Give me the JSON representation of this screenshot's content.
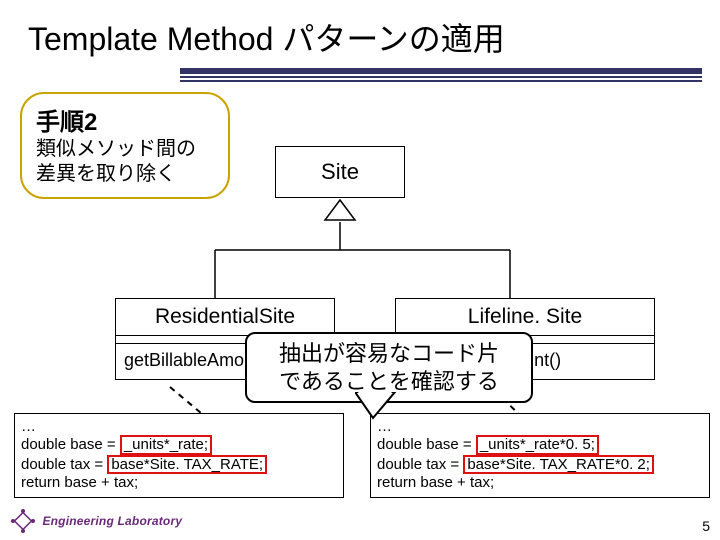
{
  "title": "Template Method パターンの適用",
  "step_box": {
    "heading": "手順2",
    "body_l1": "類似メソッド間の",
    "body_l2": "差異を取り除く"
  },
  "uml": {
    "parent": "Site",
    "left": {
      "name": "ResidentialSite",
      "op": "getBillableAmount()"
    },
    "right": {
      "name": "Lifeline. Site",
      "op": "getBillableAmount()"
    }
  },
  "speech": {
    "l1": "抽出が容易なコード片",
    "l2": "であることを確認する"
  },
  "code_left": {
    "l1": "…",
    "l2a": "double base = ",
    "l2b": "_units*_rate;",
    "l3a": "double tax = ",
    "l3b": "base*Site. TAX_RATE;",
    "l4": "return base + tax;"
  },
  "code_right": {
    "l1": "…",
    "l2a": "double base = ",
    "l2b": "_units*_rate*0. 5;",
    "l3a": "double tax = ",
    "l3b": "base*Site. TAX_RATE*0. 2;",
    "l4": "return base + tax;"
  },
  "footer": {
    "logo_text": "Engineering\nLaboratory",
    "page": "5"
  }
}
